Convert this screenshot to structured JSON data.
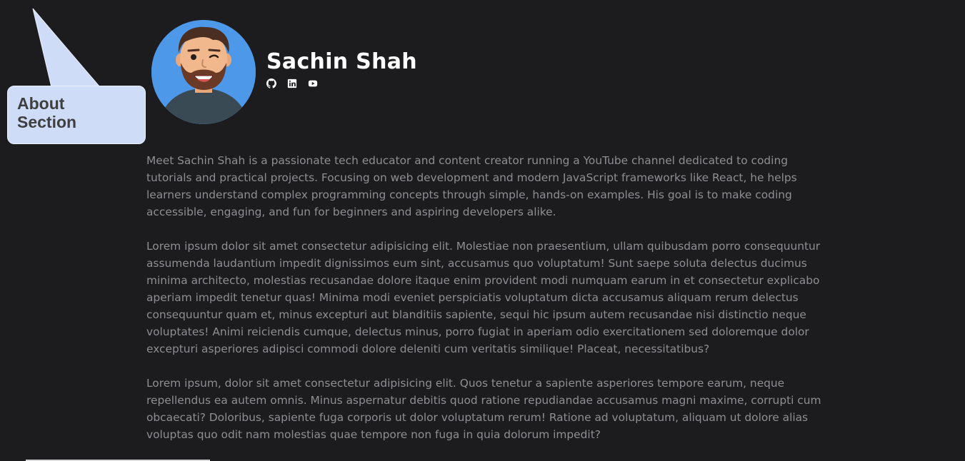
{
  "callout": {
    "label": "About\nSection",
    "fill": "#cfdcf7"
  },
  "profile": {
    "name": "Sachin Shah",
    "avatar_icon": "avatar-illustration",
    "socials": [
      {
        "icon": "github-icon"
      },
      {
        "icon": "linkedin-icon"
      },
      {
        "icon": "youtube-icon"
      }
    ]
  },
  "about": {
    "paragraphs": [
      "Meet Sachin Shah is a passionate tech educator and content creator running a YouTube channel dedicated to coding tutorials and practical projects. Focusing on web development and modern JavaScript frameworks like React, he helps learners understand complex programming concepts through simple, hands-on examples. His goal is to make coding accessible, engaging, and fun for beginners and aspiring developers alike.",
      "Lorem ipsum dolor sit amet consectetur adipisicing elit. Molestiae non praesentium, ullam quibusdam porro consequuntur assumenda laudantium impedit dignissimos eum sint, accusamus quo voluptatum! Sunt saepe soluta delectus ducimus minima architecto, molestias recusandae dolore itaque enim provident modi numquam earum in et consectetur explicabo aperiam impedit tenetur quas! Minima modi eveniet perspiciatis voluptatum dicta accusamus aliquam rerum delectus consequuntur quam et, minus excepturi aut blanditiis sapiente, sequi hic ipsum autem recusandae nisi distinctio neque voluptates! Animi reiciendis cumque, delectus minus, porro fugiat in aperiam odio exercitationem sed doloremque dolor excepturi asperiores adipisci commodi dolore deleniti cum veritatis similique! Placeat, necessitatibus?",
      "Lorem ipsum, dolor sit amet consectetur adipisicing elit. Quos tenetur a sapiente asperiores tempore earum, neque repellendus ea autem omnis. Minus aspernatur debitis quod ratione repudiandae accusamus magni maxime, corrupti cum obcaecati? Doloribus, sapiente fuga corporis ut dolor voluptatum rerum! Ratione ad voluptatum, aliquam ut dolore alias voluptas quo odit nam molestias quae tempore non fuga in quia dolorum impedit?"
    ]
  },
  "colors": {
    "background": "#1c1c1e",
    "text_muted": "#8e8e93",
    "heading": "#ffffff",
    "avatar_bg": "#4d98e8"
  }
}
